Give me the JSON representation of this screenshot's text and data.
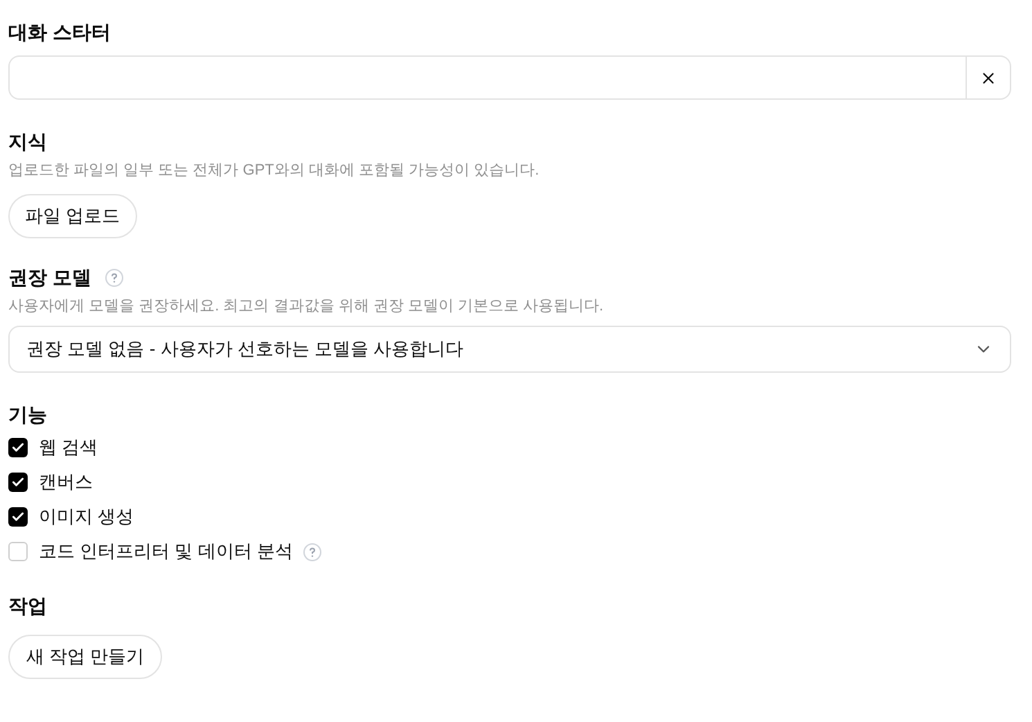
{
  "starter": {
    "label": "대화 스타터"
  },
  "knowledge": {
    "label": "지식",
    "description": "업로드한 파일의 일부 또는 전체가 GPT와의 대화에 포함될 가능성이 있습니다.",
    "button": "파일 업로드"
  },
  "model": {
    "label": "권장 모델",
    "description": "사용자에게 모델을 권장하세요. 최고의 결과값을 위해 권장 모델이 기본으로 사용됩니다.",
    "value": "권장 모델 없음 - 사용자가 선호하는 모델을 사용합니다"
  },
  "capabilities": {
    "label": "기능",
    "items": [
      {
        "label": "웹 검색",
        "checked": true,
        "help": false
      },
      {
        "label": "캔버스",
        "checked": true,
        "help": false
      },
      {
        "label": "이미지 생성",
        "checked": true,
        "help": false
      },
      {
        "label": "코드 인터프리터 및 데이터 분석",
        "checked": false,
        "help": true
      }
    ]
  },
  "actions": {
    "label": "작업",
    "button": "새 작업 만들기"
  }
}
